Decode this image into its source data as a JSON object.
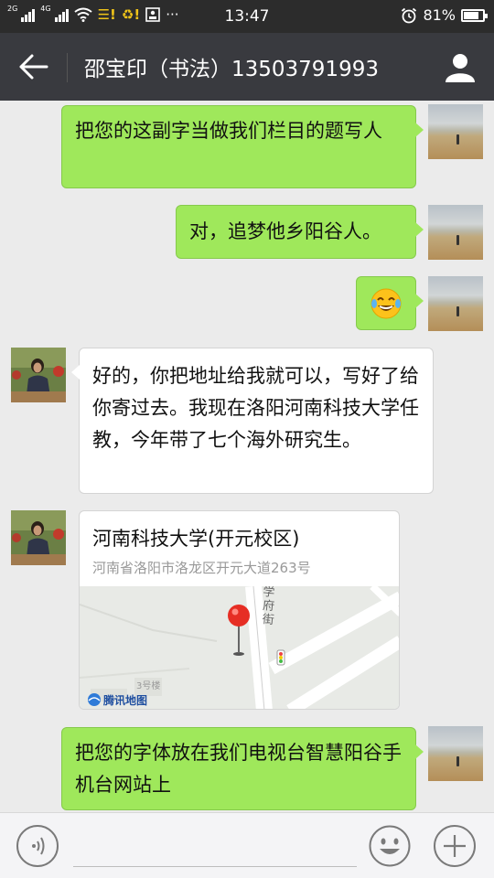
{
  "status_bar": {
    "network_left": "2G",
    "network_right": "4G",
    "notification_1": "☰!",
    "notification_2": "♻!",
    "overflow": "···",
    "time": "13:47",
    "battery": "81%",
    "battery_level": 0.81
  },
  "header": {
    "title": "邵宝印（书法）13503791993",
    "back_icon": "arrow-left",
    "profile_icon": "person"
  },
  "messages": [
    {
      "direction": "out",
      "type": "text",
      "text": "把您的这副字当做我们栏目的题写人"
    },
    {
      "direction": "out",
      "type": "text",
      "text": "对，追梦他乡阳谷人。"
    },
    {
      "direction": "out",
      "type": "emoji",
      "emoji": "😂"
    },
    {
      "direction": "in",
      "type": "text",
      "text": "好的，你把地址给我就可以，写好了给你寄过去。我现在洛阳河南科技大学任教，今年带了七个海外研究生。"
    },
    {
      "direction": "in",
      "type": "location",
      "name": "河南科技大学(开元校区)",
      "address": "河南省洛阳市洛龙区开元大道263号",
      "map_street": "学府街",
      "map_label": "3号楼",
      "map_brand": "腾讯地图"
    },
    {
      "direction": "out",
      "type": "text",
      "text": "把您的字体放在我们电视台智慧阳谷手机台网站上"
    }
  ],
  "input_bar": {
    "voice_icon": "voice",
    "emoji_icon": "smiley",
    "more_icon": "plus"
  },
  "colors": {
    "status_bg": "#2c2c2c",
    "header_bg": "#393a3f",
    "chat_bg": "#ebebeb",
    "outgoing_bubble": "#9fe85b",
    "incoming_bubble": "#ffffff"
  }
}
